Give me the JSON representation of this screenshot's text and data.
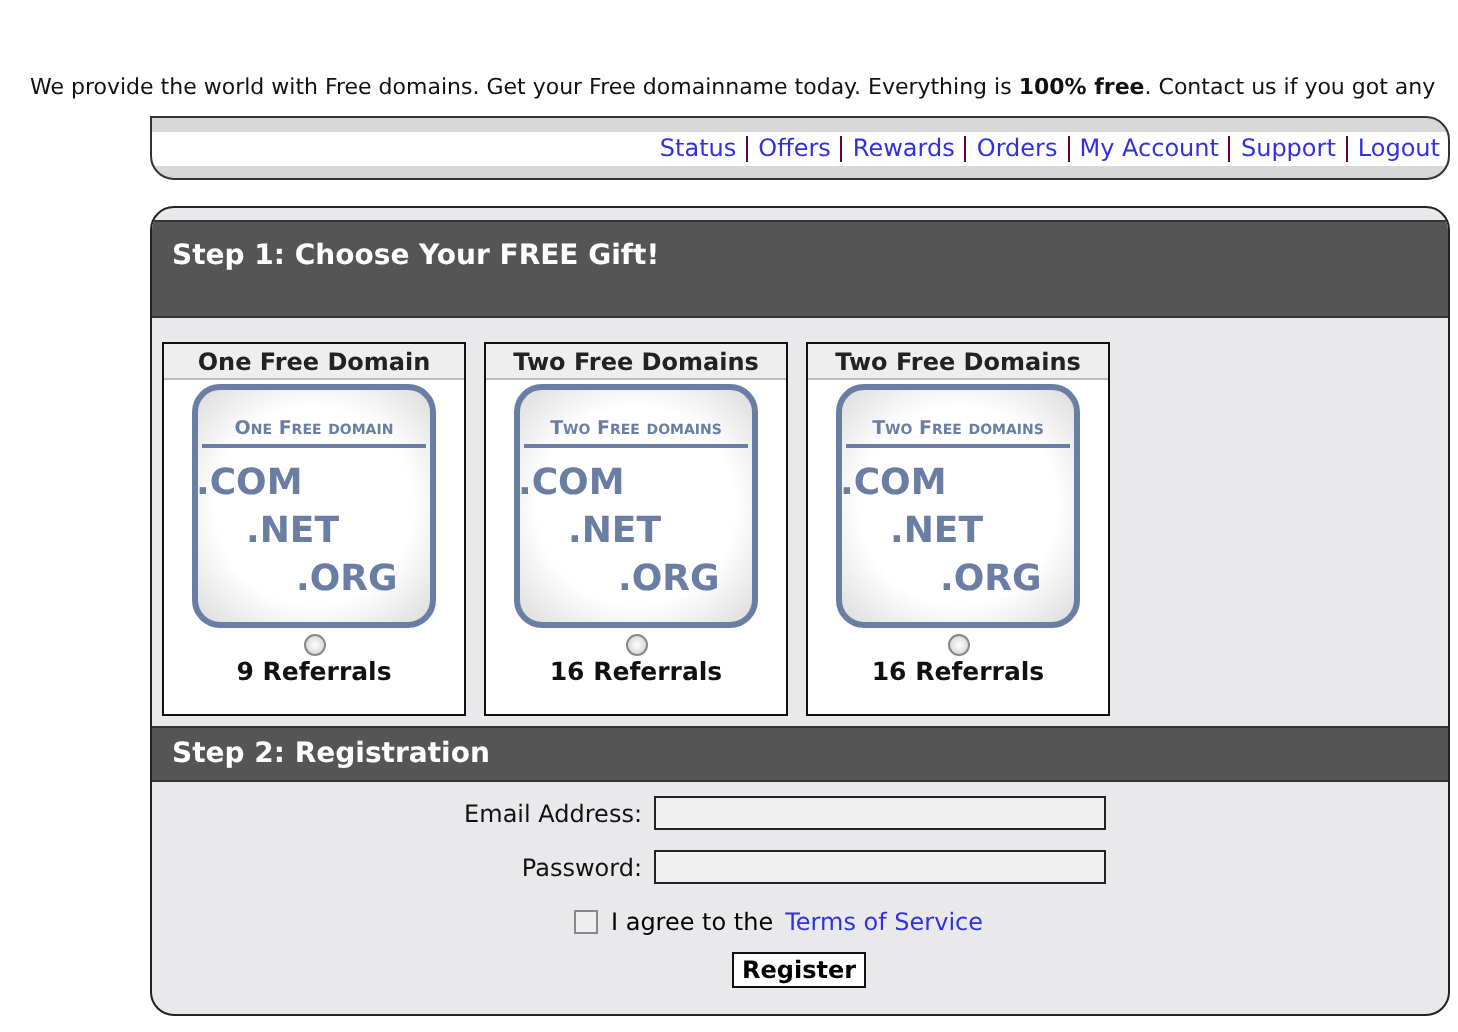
{
  "intro": "We provide the world with Free domains. Get your Free domainname today. Everything is **100% free**. Contact us if you got any",
  "nav": [
    "Status",
    "Offers",
    "Rewards",
    "Orders",
    "My Account",
    "Support",
    "Logout"
  ],
  "step1": {
    "title": "Step 1: Choose Your FREE Gift!",
    "gifts": [
      {
        "name": "One Free Domain",
        "image_title": "One Free domain",
        "extensions": [
          ".COM",
          ".NET",
          ".ORG"
        ],
        "selected": false,
        "referrals": "9 Referrals"
      },
      {
        "name": "Two Free Domains",
        "image_title": "Two Free domains",
        "extensions": [
          ".COM",
          ".NET",
          ".ORG"
        ],
        "selected": false,
        "referrals": "16 Referrals"
      },
      {
        "name": "Two Free Domains",
        "image_title": "Two Free domains",
        "extensions": [
          ".COM",
          ".NET",
          ".ORG"
        ],
        "selected": false,
        "referrals": "16 Referrals"
      }
    ]
  },
  "step2": {
    "title": "Step 2: Registration",
    "fields": [
      {
        "label": "Email Address:"
      },
      {
        "label": "Password:"
      }
    ],
    "agree": {
      "text": "I agree to the",
      "link": "Terms of Service",
      "checked": false
    },
    "button": "Register"
  }
}
